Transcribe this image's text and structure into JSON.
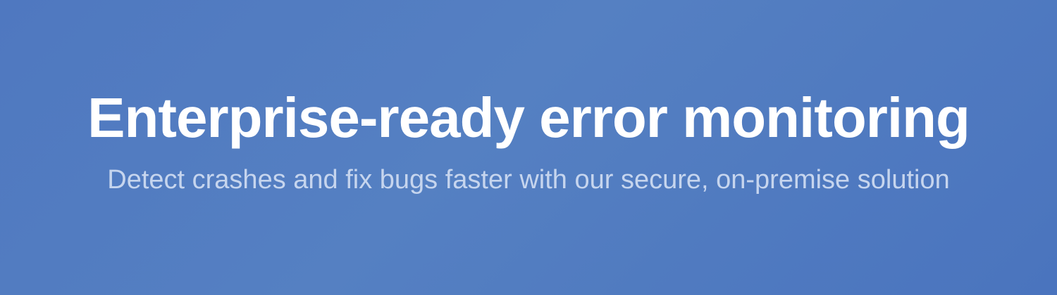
{
  "hero": {
    "title": "Enterprise-ready error monitoring",
    "subtitle": "Detect crashes and fix bugs faster with our secure, on-premise solution"
  },
  "colors": {
    "background": "#4f78c0",
    "title": "#ffffff",
    "subtitle": "#c6d5ee"
  }
}
